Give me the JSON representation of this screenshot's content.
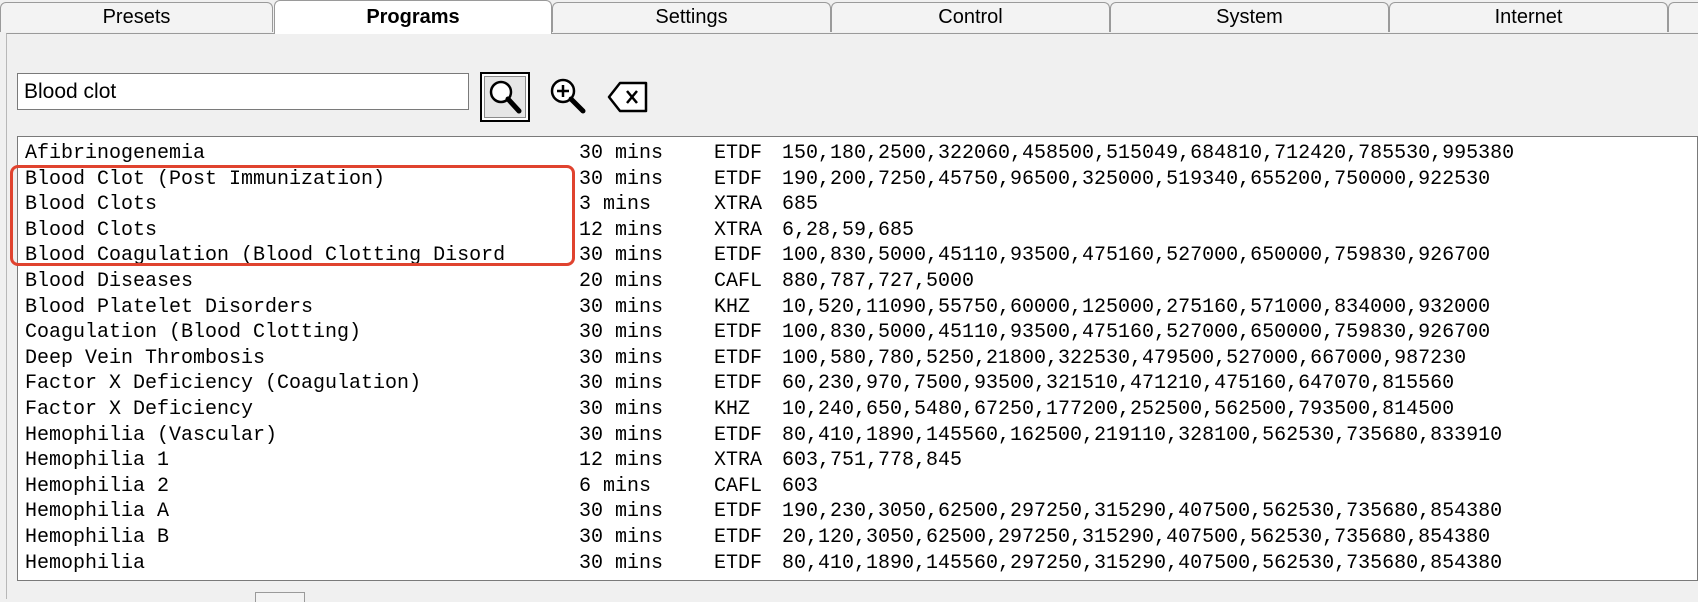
{
  "tabs": [
    {
      "label": "Presets"
    },
    {
      "label": "Programs"
    },
    {
      "label": "Settings"
    },
    {
      "label": "Control"
    },
    {
      "label": "System"
    },
    {
      "label": "Internet"
    },
    {
      "label": ""
    }
  ],
  "active_tab": "Programs",
  "search": {
    "value": "Blood clot"
  },
  "icons": {
    "search": "search-icon",
    "zoom": "zoom-in-icon",
    "clear": "backspace-clear-icon"
  },
  "colors": {
    "highlight": "#e0432f"
  },
  "results": [
    {
      "name": "Afibrinogenemia",
      "duration": "30 mins",
      "type": "ETDF",
      "frequencies": "150,180,2500,322060,458500,515049,684810,712420,785530,995380"
    },
    {
      "name": "Blood Clot (Post Immunization)",
      "duration": "30 mins",
      "type": "ETDF",
      "frequencies": "190,200,7250,45750,96500,325000,519340,655200,750000,922530"
    },
    {
      "name": "Blood Clots",
      "duration": "3 mins",
      "type": "XTRA",
      "frequencies": "685"
    },
    {
      "name": "Blood Clots",
      "duration": "12 mins",
      "type": "XTRA",
      "frequencies": "6,28,59,685"
    },
    {
      "name": "Blood Coagulation (Blood Clotting Disord",
      "duration": "30 mins",
      "type": "ETDF",
      "frequencies": "100,830,5000,45110,93500,475160,527000,650000,759830,926700"
    },
    {
      "name": "Blood Diseases",
      "duration": "20 mins",
      "type": "CAFL",
      "frequencies": "880,787,727,5000"
    },
    {
      "name": "Blood Platelet Disorders",
      "duration": "30 mins",
      "type": "KHZ",
      "frequencies": "10,520,11090,55750,60000,125000,275160,571000,834000,932000"
    },
    {
      "name": "Coagulation (Blood Clotting)",
      "duration": "30 mins",
      "type": "ETDF",
      "frequencies": "100,830,5000,45110,93500,475160,527000,650000,759830,926700"
    },
    {
      "name": "Deep Vein Thrombosis",
      "duration": "30 mins",
      "type": "ETDF",
      "frequencies": "100,580,780,5250,21800,322530,479500,527000,667000,987230"
    },
    {
      "name": "Factor X Deficiency (Coagulation)",
      "duration": "30 mins",
      "type": "ETDF",
      "frequencies": "60,230,970,7500,93500,321510,471210,475160,647070,815560"
    },
    {
      "name": "Factor X Deficiency",
      "duration": "30 mins",
      "type": "KHZ",
      "frequencies": "10,240,650,5480,67250,177200,252500,562500,793500,814500"
    },
    {
      "name": "Hemophilia (Vascular)",
      "duration": "30 mins",
      "type": "ETDF",
      "frequencies": "80,410,1890,145560,162500,219110,328100,562530,735680,833910"
    },
    {
      "name": "Hemophilia 1",
      "duration": "12 mins",
      "type": "XTRA",
      "frequencies": "603,751,778,845"
    },
    {
      "name": "Hemophilia 2",
      "duration": "6 mins",
      "type": "CAFL",
      "frequencies": "603"
    },
    {
      "name": "Hemophilia A",
      "duration": "30 mins",
      "type": "ETDF",
      "frequencies": "190,230,3050,62500,297250,315290,407500,562530,735680,854380"
    },
    {
      "name": "Hemophilia B",
      "duration": "30 mins",
      "type": "ETDF",
      "frequencies": "20,120,3050,62500,297250,315290,407500,562530,735680,854380"
    },
    {
      "name": "Hemophilia",
      "duration": "30 mins",
      "type": "ETDF",
      "frequencies": "80,410,1890,145560,297250,315290,407500,562530,735680,854380"
    }
  ]
}
